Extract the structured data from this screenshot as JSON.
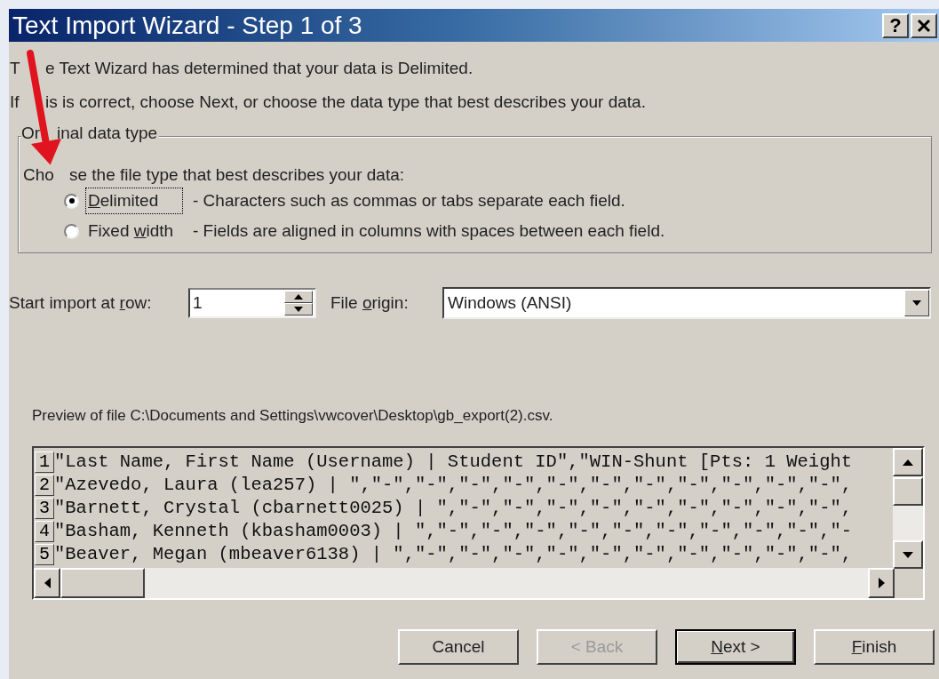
{
  "window": {
    "title": "Text Import Wizard - Step 1 of 3",
    "help_button": "?"
  },
  "intro": [
    {
      "before_arrow": "T",
      "after_arrow": "e Text Wizard has determined that your data is Delimited."
    },
    {
      "before_arrow": "If",
      "after_arrow": "is is correct, choose Next, or choose the data type that best describes your data."
    }
  ],
  "group": {
    "title_before_arrow": "Or",
    "title_after_arrow": "inal data type",
    "prompt_before_arrow": "Cho",
    "prompt_after_arrow": "se the file type that best describes your data:",
    "options": [
      {
        "label_key": "D",
        "label_post": "elimited",
        "description": "- Characters such as commas or tabs separate each field.",
        "selected": true,
        "focused": true
      },
      {
        "label_pre": "Fixed ",
        "label_key": "w",
        "label_post": "idth",
        "description": "- Fields are aligned in columns with spaces between each field.",
        "selected": false,
        "focused": false
      }
    ]
  },
  "start_row": {
    "label_pre": "Start import at ",
    "label_key": "r",
    "label_post": "ow:",
    "value": "1"
  },
  "file_origin": {
    "label_pre": "File ",
    "label_key": "o",
    "label_post": "rigin:",
    "value": "Windows (ANSI)"
  },
  "preview": {
    "caption": "Preview of file C:\\Documents and Settings\\vwcover\\Desktop\\gb_export(2).csv.",
    "rows": [
      {
        "number": "1",
        "text": "\"Last Name, First Name (Username) | Student ID\",\"WIN-Shunt [Pts: 1 Weight"
      },
      {
        "number": "2",
        "text": "\"Azevedo, Laura (lea257) | \",\"-\",\"-\",\"-\",\"-\",\"-\",\"-\",\"-\",\"-\",\"-\",\"-\",\"-\","
      },
      {
        "number": "3",
        "text": "\"Barnett, Crystal (cbarnett0025) | \",\"-\",\"-\",\"-\",\"-\",\"-\",\"-\",\"-\",\"-\",\"-\","
      },
      {
        "number": "4",
        "text": "\"Basham, Kenneth (kbasham0003) | \",\"-\",\"-\",\"-\",\"-\",\"-\",\"-\",\"-\",\"-\",\"-\",\"-"
      },
      {
        "number": "5",
        "text": "\"Beaver, Megan (mbeaver6138) | \",\"-\",\"-\",\"-\",\"-\",\"-\",\"-\",\"-\",\"-\",\"-\",\"-\","
      }
    ]
  },
  "buttons": [
    {
      "label_pre": "Cancel",
      "disabled": false,
      "default": false
    },
    {
      "label_pre": "< Back",
      "disabled": true,
      "default": false
    },
    {
      "label_key": "N",
      "label_post": "ext >",
      "disabled": false,
      "default": true
    },
    {
      "label_key": "F",
      "label_post": "inish",
      "disabled": false,
      "default": false
    }
  ]
}
